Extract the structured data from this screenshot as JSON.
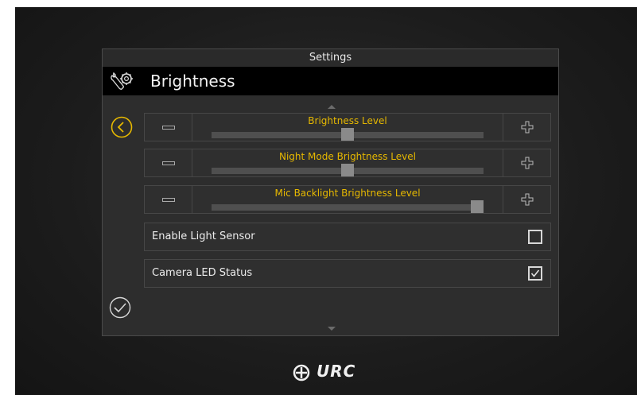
{
  "window": {
    "title": "Settings"
  },
  "header": {
    "title": "Brightness",
    "icon": "wrench-gear-icon"
  },
  "sliders": [
    {
      "label": "Brightness Level",
      "value_fraction": 0.5
    },
    {
      "label": "Night Mode Brightness Level",
      "value_fraction": 0.5
    },
    {
      "label": "Mic Backlight Brightness Level",
      "value_fraction": 1.0
    }
  ],
  "toggles": [
    {
      "label": "Enable Light Sensor",
      "checked": false
    },
    {
      "label": "Camera LED Status",
      "checked": true
    }
  ],
  "colors": {
    "accent": "#e6b800",
    "header_bg": "#000000",
    "panel_bg": "#2d2d2d"
  },
  "brand": {
    "logo_text": "URC"
  }
}
